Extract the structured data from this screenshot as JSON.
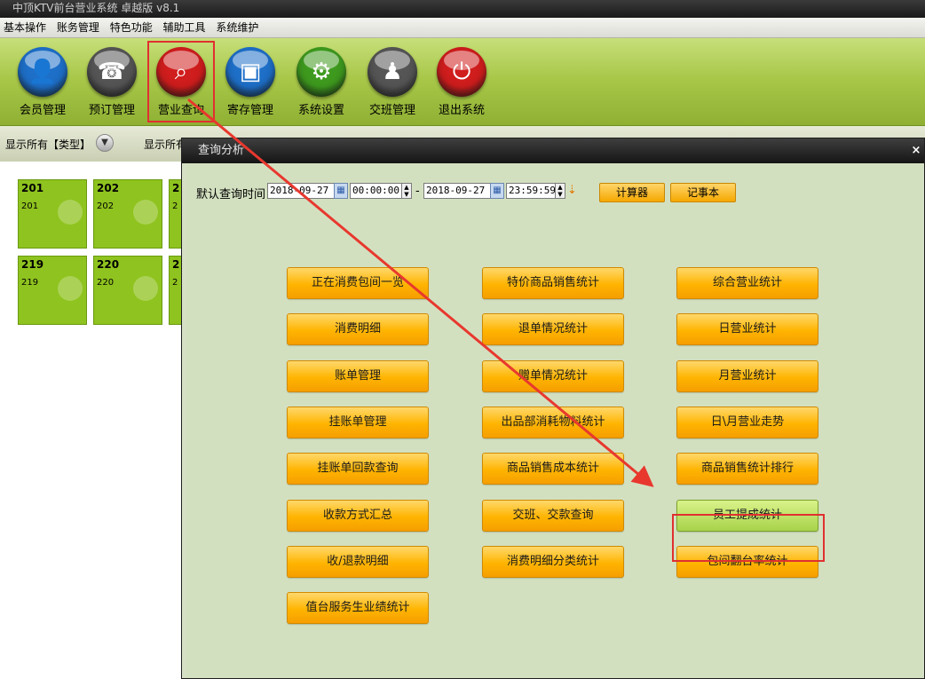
{
  "window": {
    "title": "中顶KTV前台营业系统 卓越版 v8.1"
  },
  "menu": [
    "基本操作",
    "账务管理",
    "特色功能",
    "辅助工具",
    "系统维护"
  ],
  "toolbar": [
    {
      "label": "会员管理",
      "icon": "member-icon",
      "color": "#1e6fc8",
      "glyph": "👤"
    },
    {
      "label": "预订管理",
      "icon": "phone-icon",
      "color": "#555555",
      "glyph": "☎"
    },
    {
      "label": "营业查询",
      "icon": "search-icon",
      "color": "#d01d1d",
      "glyph": "⌕"
    },
    {
      "label": "寄存管理",
      "icon": "bag-icon",
      "color": "#1e6fc8",
      "glyph": "▣"
    },
    {
      "label": "系统设置",
      "icon": "gear-icon",
      "color": "#3e9a1e",
      "glyph": "⚙"
    },
    {
      "label": "交班管理",
      "icon": "team-icon",
      "color": "#555555",
      "glyph": "♟"
    },
    {
      "label": "退出系统",
      "icon": "power-icon",
      "color": "#d01d1d",
      "glyph": "⏻"
    }
  ],
  "filter": {
    "label1": "显示所有【类型】",
    "label2": "显示所有"
  },
  "rooms": [
    {
      "no": "201",
      "sub": "201"
    },
    {
      "no": "202",
      "sub": "202"
    },
    {
      "no": "2",
      "sub": "2"
    },
    {
      "no": "219",
      "sub": "219"
    },
    {
      "no": "220",
      "sub": "220"
    },
    {
      "no": "2",
      "sub": "2"
    }
  ],
  "dialog": {
    "title": "查询分析",
    "close": "×",
    "query_label": "默认查询时间",
    "date_from": "2018-09-27",
    "time_from": "00:00:00",
    "date_to": "2018-09-27",
    "time_to": "23:59:59",
    "dash": "-",
    "calculator": "计算器",
    "notepad": "记事本",
    "buttons_col1": [
      "正在消费包间一览",
      "消费明细",
      "账单管理",
      "挂账单管理",
      "挂账单回款查询",
      "收款方式汇总",
      "收/退款明细",
      "值台服务生业绩统计"
    ],
    "buttons_col2": [
      "特价商品销售统计",
      "退单情况统计",
      "赠单情况统计",
      "出品部消耗物料统计",
      "商品销售成本统计",
      "交班、交款查询",
      "消费明细分类统计"
    ],
    "buttons_col3": [
      "综合营业统计",
      "日营业统计",
      "月营业统计",
      "日\\月营业走势",
      "商品销售统计排行",
      "员工提成统计",
      "包间翻台率统计"
    ],
    "selected": "员工提成统计"
  },
  "colors": {
    "accent": "#ffb400",
    "highlight": "#e03030",
    "toolbar": "#a9c84a",
    "room": "#8fc31f"
  }
}
